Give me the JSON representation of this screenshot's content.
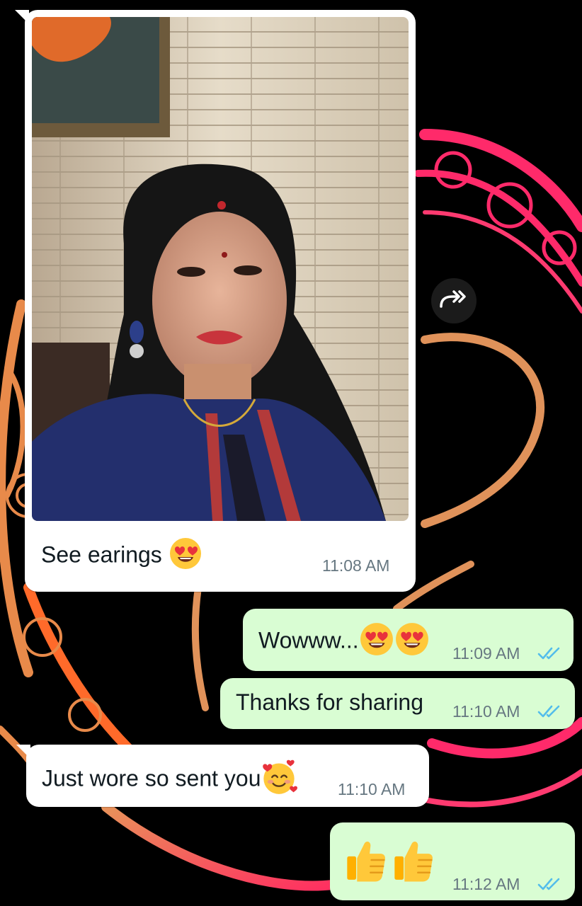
{
  "chat": {
    "messages": [
      {
        "direction": "incoming",
        "type": "image",
        "caption": "See earings",
        "time": "11:08 AM"
      },
      {
        "direction": "outgoing",
        "text": "Wowww...",
        "time": "11:09 AM",
        "status": "read"
      },
      {
        "direction": "outgoing",
        "text": "Thanks for sharing",
        "time": "11:10 AM",
        "status": "read"
      },
      {
        "direction": "incoming",
        "text": "Just wore so sent you",
        "time": "11:10 AM"
      },
      {
        "direction": "outgoing",
        "text": "",
        "time": "11:12 AM",
        "status": "read"
      }
    ]
  },
  "icons": {
    "forward": "forward-icon",
    "read_receipt": "double-check-icon",
    "heart_eyes": "heart-eyes-emoji",
    "smiling_hearts": "smiling-face-with-hearts-emoji",
    "thumbs_up": "thumbs-up-emoji"
  },
  "colors": {
    "incoming_bubble": "#ffffff",
    "outgoing_bubble": "#d9fdd3",
    "read_tick": "#53bdeb",
    "wallpaper": "#000000",
    "wallpaper_orange": "#e88a4a",
    "wallpaper_pink": "#ff2a6a"
  }
}
